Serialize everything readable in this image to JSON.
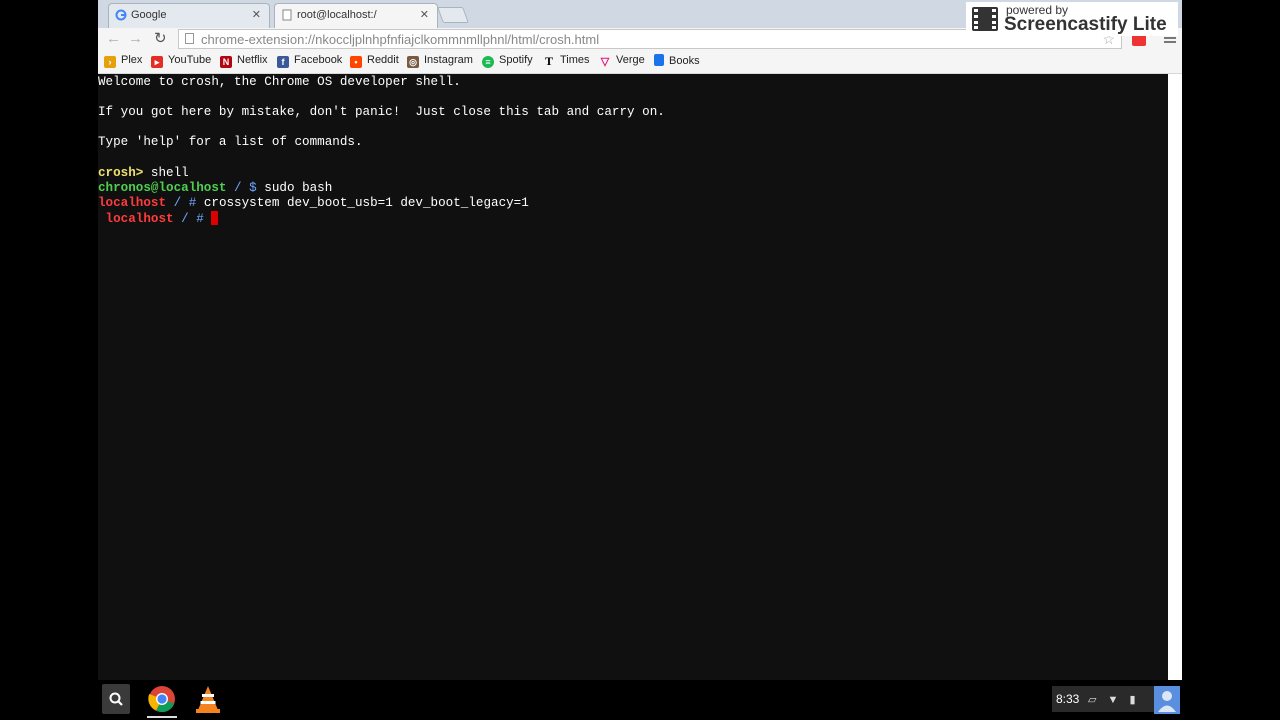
{
  "tabs": [
    {
      "title": "Google"
    },
    {
      "title": "root@localhost:/"
    }
  ],
  "omnibox": {
    "url": "chrome-extension://nkoccljplnhpfnfiajclkommnmllphnl/html/crosh.html"
  },
  "bookmarks": [
    {
      "label": "Plex",
      "icon": "plex-icon",
      "color": "#e5a00d"
    },
    {
      "label": "YouTube",
      "icon": "youtube-icon",
      "color": "#e52d27"
    },
    {
      "label": "Netflix",
      "icon": "netflix-icon",
      "color": "#b20710"
    },
    {
      "label": "Facebook",
      "icon": "facebook-icon",
      "color": "#3b5998"
    },
    {
      "label": "Reddit",
      "icon": "reddit-icon",
      "color": "#ff4500"
    },
    {
      "label": "Instagram",
      "icon": "instagram-icon",
      "color": "#7a5a40"
    },
    {
      "label": "Spotify",
      "icon": "spotify-icon",
      "color": "#1db954"
    },
    {
      "label": "Times",
      "icon": "nytimes-icon",
      "color": "#000000"
    },
    {
      "label": "Verge",
      "icon": "verge-icon",
      "color": "#e2127a"
    },
    {
      "label": "Books",
      "icon": "books-icon",
      "color": "#1a73e8"
    }
  ],
  "terminal": {
    "line1": "Welcome to crosh, the Chrome OS developer shell.",
    "line2": "If you got here by mistake, don't panic!  Just close this tab and carry on.",
    "line3": "Type 'help' for a list of commands.",
    "crosh_prompt": "crosh>",
    "crosh_cmd": " shell",
    "chronos_host": "chronos@localhost",
    "chronos_path": " / $",
    "chronos_cmd": " sudo bash",
    "root_host": "localhost",
    "root_path": " / #",
    "root_cmd": " crossystem dev_boot_usb=1 dev_boot_legacy=1",
    "root_host2": " localhost",
    "root_path2": " / #"
  },
  "screencastify": {
    "small": "powered by",
    "big": "Screencastify Lite"
  },
  "shelf": {
    "time": "8:33"
  }
}
